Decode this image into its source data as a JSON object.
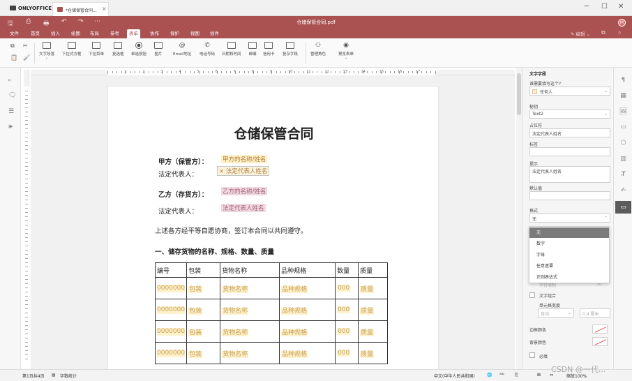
{
  "app": {
    "name": "ONLYOFFICE",
    "tab_title": "*仓储保管合同...",
    "doc_title": "仓储保管合同.pdf",
    "avatar": "M",
    "accent": "#aa5252"
  },
  "window": {
    "min": "─",
    "max": "☐",
    "close": "✕"
  },
  "quick": {
    "save": "🖫",
    "print": "⎙",
    "quickprint": "🖶",
    "undo": "↶",
    "redo": "↷",
    "more": "⋯"
  },
  "menu_tabs": [
    "文件",
    "首页",
    "插入",
    "绘图",
    "布局",
    "参考",
    "表单",
    "协作",
    "保护",
    "视图",
    "插件"
  ],
  "menu_active": "表单",
  "edit_button": "编辑",
  "ribbon": {
    "copy": "⧉",
    "cut": "✂",
    "paste": "📋",
    "brush": "🖌",
    "items": [
      {
        "icon": "text-field-icon",
        "label": "文字段落"
      },
      {
        "icon": "combo-box-icon",
        "label": "下拉式方框"
      },
      {
        "icon": "dropdown-icon",
        "label": "下拉菜单"
      },
      {
        "icon": "checkbox-icon",
        "label": "复选框"
      },
      {
        "icon": "radio-icon",
        "label": "单选按钮"
      },
      {
        "icon": "image-icon",
        "label": "图片"
      },
      {
        "icon": "email-icon",
        "label": "Email地址"
      },
      {
        "icon": "phone-icon",
        "label": "电话号码"
      },
      {
        "icon": "datetime-icon",
        "label": "日期和时间"
      },
      {
        "icon": "zip-icon",
        "label": "邮编"
      },
      {
        "icon": "credit-card-icon",
        "label": "信用卡"
      },
      {
        "icon": "complex-field-icon",
        "label": "复杂字段"
      },
      {
        "icon": "manage-roles-icon",
        "label": "管理角色"
      },
      {
        "icon": "preview-form-icon",
        "label": "预览表单"
      }
    ]
  },
  "ruler": {
    "numbers": [
      "1",
      "2",
      "3",
      "4",
      "5",
      "6",
      "7",
      "8",
      "9",
      "10",
      "11",
      "12",
      "13",
      "14",
      "15",
      "16",
      "17"
    ]
  },
  "document": {
    "title": "仓储保管合同",
    "party_a_label": "甲方（保管方）：",
    "party_a_value": "甲方的名称/姓名",
    "legal_rep_label": "法定代表人：",
    "legal_rep_a_value": "法定代表人姓名",
    "party_b_label": "乙方（存货方）：",
    "party_b_value": "乙方的名称/姓名",
    "legal_rep_b_value": "法定代表人姓名",
    "agreement_text": "上述各方经平等自愿协商，签订本合同以共同遵守。",
    "section1_title": "一、储存货物的名称、规格、数量、质量",
    "table": {
      "headers": [
        "编号",
        "包装",
        "货物名称",
        "品种规格",
        "数量",
        "质量"
      ],
      "rows": [
        [
          "0000000",
          "包装",
          "货物名称",
          "品种规格",
          "000",
          "质量"
        ],
        [
          "0000000",
          "包装",
          "货物名称",
          "品种规格",
          "000",
          "质量"
        ],
        [
          "0000000",
          "包装",
          "货物名称",
          "品种规格",
          "000",
          "质量"
        ],
        [
          "0000000",
          "包装",
          "货物名称",
          "品种规格",
          "000",
          "质量"
        ]
      ]
    }
  },
  "panel": {
    "title": "文字字段",
    "who_fills_label": "谁需要填写这个?",
    "who_fills_value": "任何人",
    "key_label": "秘钥",
    "key_value": "Text2",
    "placeholder_label": "占位符",
    "placeholder_value": "法定代表人姓名",
    "tag_label": "标签",
    "tag_value": "",
    "tip_label": "提示",
    "tip_value": "法定代表人姓名",
    "default_label": "默认值",
    "default_value": "",
    "format_label": "格式",
    "format_value": "无",
    "format_options": [
      "无",
      "数字",
      "字母",
      "任意遮罩",
      "正则表达式"
    ],
    "chars_limit_label": "字符限制",
    "chars_limit_value": "10",
    "comb_label": "文字组合",
    "cell_width_label": "单元格宽度",
    "cell_width_value": "自动",
    "cell_width_unit": "0.4 厘米",
    "border_color_label": "边框颜色",
    "bg_color_label": "背景颜色",
    "required_label": "必填"
  },
  "status": {
    "page": "第1页共4页",
    "word_count": "字数统计",
    "language": "中文(中华人民共和国)",
    "zoom": "缩放100%"
  },
  "watermark": "CSDN @一代..."
}
